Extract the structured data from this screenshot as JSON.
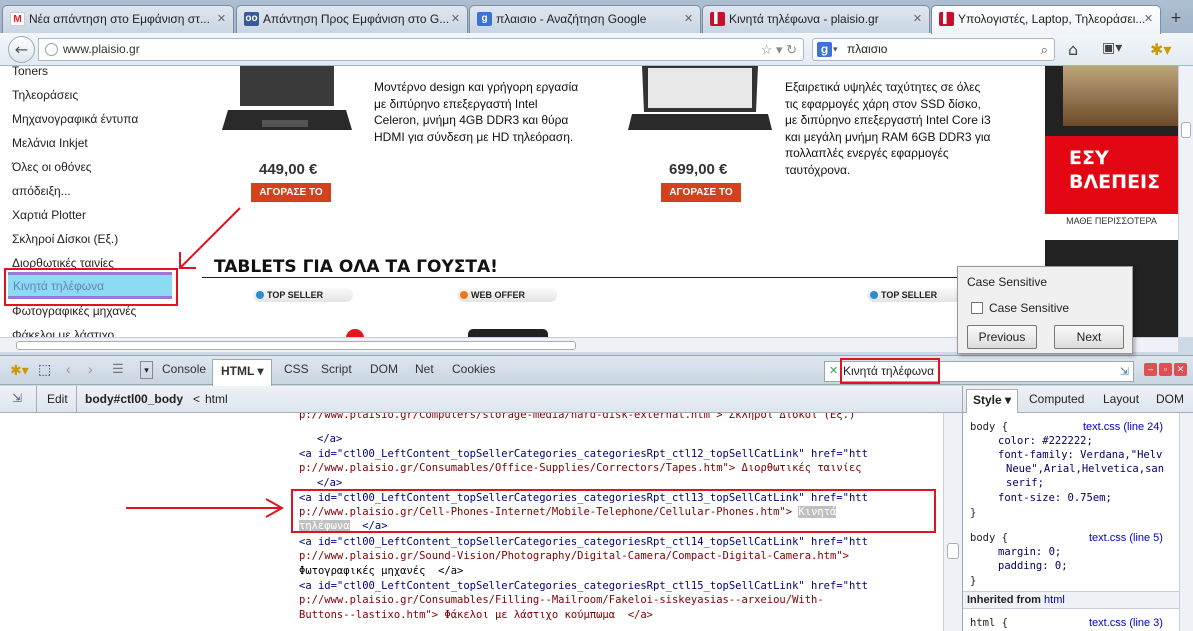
{
  "tabs": [
    {
      "label": "Νέα απάντηση στο Εμφάνιση στ...",
      "icon": "gmail-icon"
    },
    {
      "label": "Απάντηση Προς Εμφάνιση στο G...",
      "icon": "blogger-icon"
    },
    {
      "label": "πλαισιο - Αναζήτηση Google",
      "icon": "google-icon"
    },
    {
      "label": "Κινητά τηλέφωνα - plaisio.gr",
      "icon": "plaisio-icon"
    },
    {
      "label": "Υπολογιστές, Laptop, Τηλεοράσει...",
      "icon": "plaisio-icon"
    }
  ],
  "nav": {
    "url": "www.plaisio.gr",
    "search": "πλαισιο"
  },
  "page": {
    "categories": [
      "Toners",
      "Τηλεοράσεις",
      "Μηχανογραφικά έντυπα",
      "Μελάνια Inkjet",
      "Όλες οι οθόνες",
      "απόδειξη...",
      "Χαρτιά Plotter",
      "Σκληροί Δίσκοι (Εξ.)",
      "Διορθωτικές ταινίες",
      "Κινητά τηλέφωνα",
      "Φωτογραφικές μηχανές",
      "Φάκελοι με λάστιχο"
    ],
    "products": [
      {
        "price": "449,00 €",
        "buy": "ΑΓΟΡΑΣΕ ΤΟ",
        "desc": [
          "Μοντέρνο design και γρήγορη εργασία",
          "με διπύρηνο επεξεργαστή Intel",
          "Celeron, μνήμη 4GB DDR3 και θύρα",
          "HDMI για σύνδεση με HD τηλεόραση."
        ]
      },
      {
        "price": "699,00 €",
        "buy": "ΑΓΟΡΑΣΕ ΤΟ",
        "desc": [
          "Εξαιρετικά υψηλές ταχύτητες σε όλες",
          "τις εφαρμογές χάρη στον SSD δίσκο,",
          "με διπύρηνο επεξεργαστή Intel Core i3",
          "και μεγάλη μνήμη RAM 6GB DDR3 για",
          "πολλαπλές ενεργές εφαρμογές",
          "ταυτόχρονα."
        ]
      }
    ],
    "tablets_heading": "TABLETS ΓΙΑ ΟΛΑ ΤΑ ΓΟΥΣΤΑ!",
    "badges": [
      "TOP SELLER",
      "WEB OFFER",
      "TOP SELLER"
    ],
    "ad1_text": [
      "ΕΣΥ",
      "ΒΛΕΠΕΙΣ"
    ],
    "ad1_footer": "ΜΑΘΕ ΠΕΡΙΣΣΟΤΕΡΑ"
  },
  "find_popup": {
    "title": "Case Sensitive",
    "checkbox_label": "Case Sensitive",
    "previous": "Previous",
    "next": "Next"
  },
  "firebug": {
    "tabs": [
      "Console",
      "HTML",
      "CSS",
      "Script",
      "DOM",
      "Net",
      "Cookies"
    ],
    "search_value": "Κινητά τηλέφωνα",
    "edit": "Edit",
    "breadcrumb_current": "body#ctl00_body",
    "breadcrumb_parent": "html",
    "side_tabs": [
      "Style",
      "Computed",
      "Layout",
      "DOM"
    ],
    "code_lines": [
      {
        "indent": 0,
        "text": "p://www.plaisio.gr/Computers/storage-media/hard-disk-external.htm\"> Σκληροί Δίσκοι (Εξ.)"
      },
      {
        "indent": 0,
        "text": "</a>"
      },
      {
        "indent": 0,
        "text": "<a id=\"ctl00_LeftContent_topSellerCategories_categoriesRpt_ctl12_topSellCatLink\" href=\"htt"
      },
      {
        "indent": 0,
        "text": "p://www.plaisio.gr/Consumables/Office-Supplies/Correctors/Tapes.htm\"> Διορθωτικές ταινίες"
      },
      {
        "indent": 0,
        "text": "</a>"
      },
      {
        "indent": 0,
        "text": "<a id=\"ctl00_LeftContent_topSellerCategories_categoriesRpt_ctl13_topSellCatLink\" href=\"htt"
      },
      {
        "indent": 0,
        "text": "p://www.plaisio.gr/Cell-Phones-Internet/Mobile-Telephone/Cellular-Phones.htm\">"
      },
      {
        "indent": 0,
        "text": "</a>"
      },
      {
        "indent": 0,
        "text": "<a id=\"ctl00_LeftContent_topSellerCategories_categoriesRpt_ctl14_topSellCatLink\" href=\"htt"
      },
      {
        "indent": 0,
        "text": "p://www.plaisio.gr/Sound-Vision/Photography/Digital-Camera/Compact-Digital-Camera.htm\">"
      },
      {
        "indent": 0,
        "text": "Φωτογραφικές μηχανές  </a>"
      },
      {
        "indent": 0,
        "text": "<a id=\"ctl00_LeftContent_topSellerCategories_categoriesRpt_ctl15_topSellCatLink\" href=\"htt"
      },
      {
        "indent": 0,
        "text": "p://www.plaisio.gr/Consumables/Filling--Mailroom/Fakeloi-siskeyasias--arxeiou/With-"
      },
      {
        "indent": 0,
        "text": "Buttons--lastixo.htm\"> Φάκελοι με λάστιχο κούμπωμα  </a>"
      }
    ],
    "highlight_text_1": "Κινητά",
    "highlight_text_2": "τηλέφωνα",
    "styles": {
      "rule1_selector": "body {",
      "rule1_link": "text.css (line 24)",
      "rule1_props": [
        "color: #222222;",
        "font-family: Verdana,\"Helv",
        "Neue\",Arial,Helvetica,san",
        "serif;",
        "font-size: 0.75em;"
      ],
      "rule2_selector": "body {",
      "rule2_link": "text.css (line 5)",
      "rule2_props": [
        "margin: 0;",
        "padding: 0;"
      ],
      "inherited": "Inherited from",
      "inherited_link": "html",
      "rule3_selector": "html {",
      "rule3_link": "text.css (line 3)"
    }
  }
}
